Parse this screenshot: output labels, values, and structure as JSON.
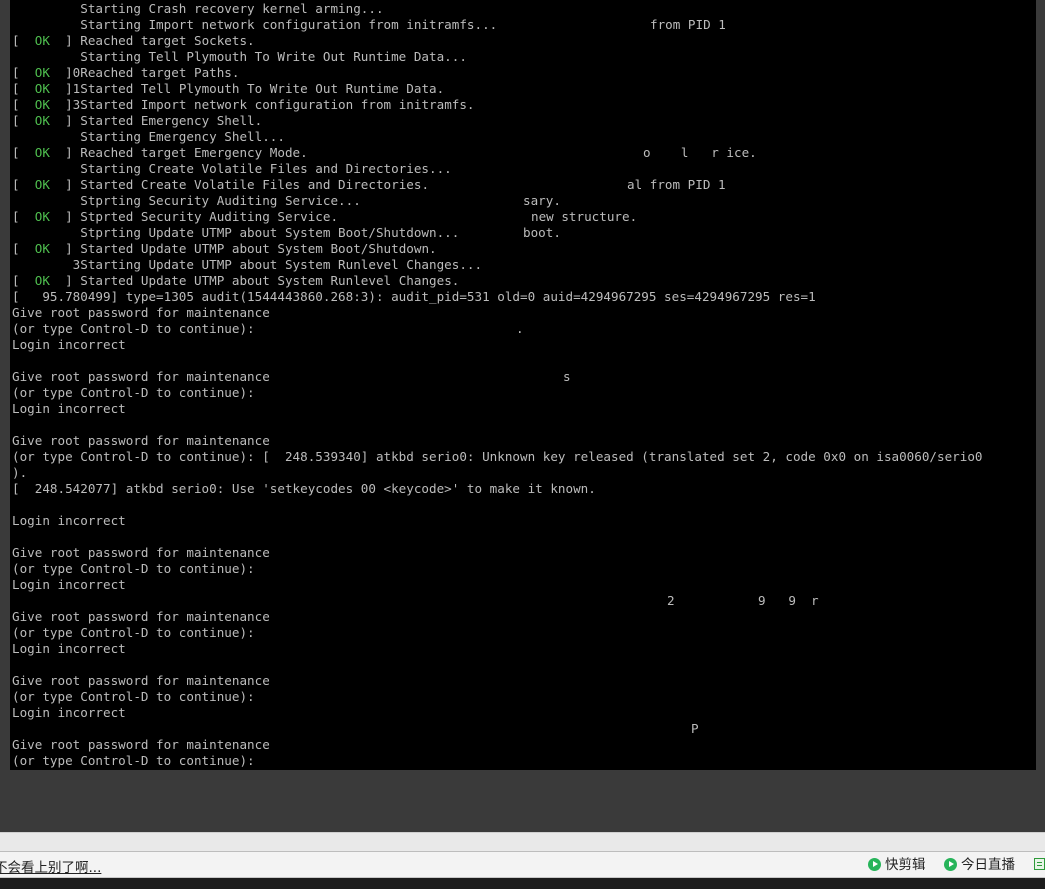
{
  "terminal": {
    "lines": [
      [
        {
          "t": "         Starting Crash recovery kernel arming..."
        }
      ],
      [
        {
          "t": "         Starting Import network configuration from initramfs..."
        }
      ],
      [
        {
          "t": "[  "
        },
        {
          "t": "OK",
          "ok": true
        },
        {
          "t": "  ] Reached target Sockets."
        }
      ],
      [
        {
          "t": "         Starting Tell Plymouth To Write Out Runtime Data..."
        }
      ],
      [
        {
          "t": "[  "
        },
        {
          "t": "OK",
          "ok": true
        },
        {
          "t": "  ]0Reached target Paths."
        }
      ],
      [
        {
          "t": "[  "
        },
        {
          "t": "OK",
          "ok": true
        },
        {
          "t": "  ]1Started Tell Plymouth To Write Out Runtime Data."
        }
      ],
      [
        {
          "t": "[  "
        },
        {
          "t": "OK",
          "ok": true
        },
        {
          "t": "  ]3Started Import network configuration from initramfs."
        }
      ],
      [
        {
          "t": "[  "
        },
        {
          "t": "OK",
          "ok": true
        },
        {
          "t": "  ] Started Emergency Shell."
        }
      ],
      [
        {
          "t": "         Starting Emergency Shell..."
        }
      ],
      [
        {
          "t": "[  "
        },
        {
          "t": "OK",
          "ok": true
        },
        {
          "t": "  ] Reached target Emergency Mode."
        }
      ],
      [
        {
          "t": "         Starting Create Volatile Files and Directories..."
        }
      ],
      [
        {
          "t": "[  "
        },
        {
          "t": "OK",
          "ok": true
        },
        {
          "t": "  ] Started Create Volatile Files and Directories."
        }
      ],
      [
        {
          "t": "         Stprting Security Auditing Service..."
        }
      ],
      [
        {
          "t": "[  "
        },
        {
          "t": "OK",
          "ok": true
        },
        {
          "t": "  ] Stprted Security Auditing Service."
        }
      ],
      [
        {
          "t": "         Stprting Update UTMP about System Boot/Shutdown..."
        }
      ],
      [
        {
          "t": "[  "
        },
        {
          "t": "OK",
          "ok": true
        },
        {
          "t": "  ] Started Update UTMP about System Boot/Shutdown."
        }
      ],
      [
        {
          "t": "        3Starting Update UTMP about System Runlevel Changes..."
        }
      ],
      [
        {
          "t": "[  "
        },
        {
          "t": "OK",
          "ok": true
        },
        {
          "t": "  ] Started Update UTMP about System Runlevel Changes."
        }
      ],
      [
        {
          "t": "[   95.780499] type=1305 audit(1544443860.268:3): audit_pid=531 old=0 auid=4294967295 ses=4294967295 res=1"
        }
      ],
      [
        {
          "t": "Give root password for maintenance"
        }
      ],
      [
        {
          "t": "(or type Control-D to continue):"
        }
      ],
      [
        {
          "t": "Login incorrect"
        }
      ],
      [
        {
          "t": ""
        }
      ],
      [
        {
          "t": "Give root password for maintenance"
        }
      ],
      [
        {
          "t": "(or type Control-D to continue):"
        }
      ],
      [
        {
          "t": "Login incorrect"
        }
      ],
      [
        {
          "t": ""
        }
      ],
      [
        {
          "t": "Give root password for maintenance"
        }
      ],
      [
        {
          "t": "(or type Control-D to continue): [  248.539340] atkbd serio0: Unknown key released (translated set 2, code 0x0 on isa0060/serio0"
        }
      ],
      [
        {
          "t": ")."
        }
      ],
      [
        {
          "t": "[  248.542077] atkbd serio0: Use 'setkeycodes 00 <keycode>' to make it known."
        }
      ],
      [
        {
          "t": ""
        }
      ],
      [
        {
          "t": "Login incorrect"
        }
      ],
      [
        {
          "t": ""
        }
      ],
      [
        {
          "t": "Give root password for maintenance"
        }
      ],
      [
        {
          "t": "(or type Control-D to continue):"
        }
      ],
      [
        {
          "t": "Login incorrect"
        }
      ],
      [
        {
          "t": ""
        }
      ],
      [
        {
          "t": "Give root password for maintenance"
        }
      ],
      [
        {
          "t": "(or type Control-D to continue):"
        }
      ],
      [
        {
          "t": "Login incorrect"
        }
      ],
      [
        {
          "t": ""
        }
      ],
      [
        {
          "t": "Give root password for maintenance"
        }
      ],
      [
        {
          "t": "(or type Control-D to continue):"
        }
      ],
      [
        {
          "t": "Login incorrect"
        }
      ],
      [
        {
          "t": ""
        }
      ],
      [
        {
          "t": "Give root password for maintenance"
        }
      ],
      [
        {
          "t": "(or type Control-D to continue):"
        }
      ]
    ],
    "margin_fragments": [
      {
        "text": "from PID 1"
      },
      {
        "text": "o    l   r ice."
      },
      {
        "text": "al from PID 1"
      },
      {
        "text": "sary."
      },
      {
        "text": "new structure."
      },
      {
        "text": "boot."
      },
      {
        "text": "."
      },
      {
        "text": "s"
      },
      {
        "text": "2           9   9  r"
      },
      {
        "text": "P"
      }
    ]
  },
  "taskbar": {
    "link_text": "不会看上别了啊...",
    "buttons": [
      {
        "label": "快剪辑",
        "icon": "play-circle-icon"
      },
      {
        "label": "今日直播",
        "icon": "play-circle-icon"
      }
    ]
  },
  "colors": {
    "terminal_bg": "#000000",
    "terminal_text": "#bcbcbc",
    "ok_green": "#4fbf4f",
    "desktop_bg": "#3a3a3a",
    "taskbar_bg": "#f3f3f3",
    "icon_green": "#27b45a"
  }
}
